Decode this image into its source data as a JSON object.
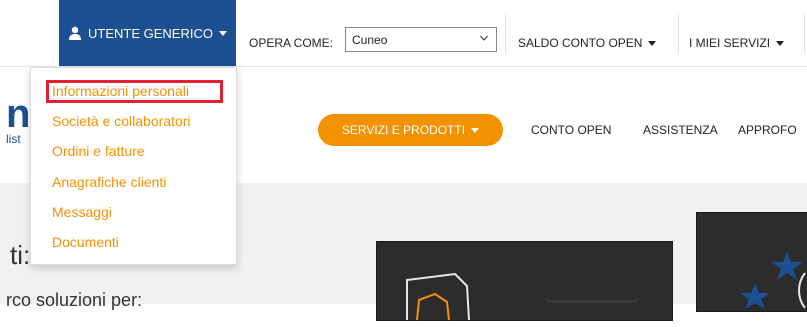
{
  "topbar": {
    "user_label": "UTENTE GENERICO",
    "opera_label": "OPERA COME:",
    "opera_value": "Cuneo",
    "saldo_label": "SALDO CONTO OPEN",
    "servizi_label": "I MIEI SERVIZI"
  },
  "nav": {
    "servizi_prodotti": "SERVIZI E PRODOTTI",
    "conto_open": "CONTO OPEN",
    "assistenza": "ASSISTENZA",
    "approfondimenti": "APPROFO"
  },
  "logo": {
    "letter": "n",
    "sub": "list"
  },
  "hero": {
    "title": "ti:",
    "subtitle": "rco soluzioni per:"
  },
  "dropdown": {
    "items": [
      "Informazioni personali",
      "Società e collaboratori",
      "Ordini e fatture",
      "Anagrafiche clienti",
      "Messaggi",
      "Documenti"
    ],
    "highlighted_index": 0,
    "highlight_color": "#e2202e"
  },
  "colors": {
    "brand_blue": "#1d4f93",
    "accent_orange": "#f39200"
  }
}
